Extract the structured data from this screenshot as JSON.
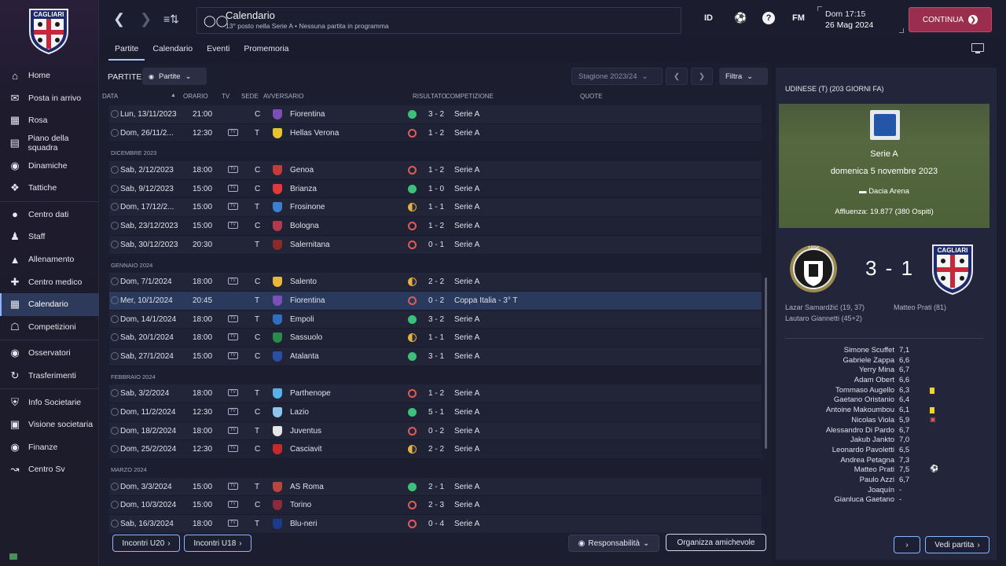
{
  "topbar": {
    "title": "Calendario",
    "subtitle": "13° posto nella Serie A • Nessuna partita in programma",
    "id_label": "ID",
    "help_label": "?",
    "fm_label": "FM",
    "date_line1": "Dom 17:15",
    "date_line2": "26 Mag 2024",
    "continue_label": "CONTINUA"
  },
  "sidebar": {
    "items": [
      {
        "label": "Home",
        "icon": "home-icon"
      },
      {
        "label": "Posta in arrivo",
        "icon": "mail-icon"
      },
      {
        "label": "Rosa",
        "icon": "shirt-icon"
      },
      {
        "label": "Piano della squadra",
        "icon": "clipboard-icon"
      },
      {
        "label": "Dinamiche",
        "icon": "brain-icon"
      },
      {
        "label": "Tattiche",
        "icon": "tactics-icon"
      },
      {
        "label": "Centro dati",
        "icon": "data-icon"
      },
      {
        "label": "Staff",
        "icon": "staff-icon"
      },
      {
        "label": "Allenamento",
        "icon": "cone-icon"
      },
      {
        "label": "Centro medico",
        "icon": "medical-icon"
      },
      {
        "label": "Calendario",
        "icon": "calendar-icon"
      },
      {
        "label": "Competizioni",
        "icon": "trophy-icon"
      },
      {
        "label": "Osservatori",
        "icon": "binoculars-icon"
      },
      {
        "label": "Trasferimenti",
        "icon": "transfer-icon"
      },
      {
        "label": "Info Societarie",
        "icon": "shield-icon"
      },
      {
        "label": "Visione societaria",
        "icon": "briefcase-icon"
      },
      {
        "label": "Finanze",
        "icon": "coins-icon"
      },
      {
        "label": "Centro Sv",
        "icon": "development-icon"
      }
    ],
    "active": "Calendario"
  },
  "tabs": [
    "Partite",
    "Calendario",
    "Eventi",
    "Promemoria"
  ],
  "active_tab": "Partite",
  "toolbar": {
    "label": "PARTITE",
    "view_dropdown": "Partite",
    "season": "Stagione 2023/24",
    "filter": "Filtra"
  },
  "columns": {
    "data": "DATA",
    "orario": "ORARIO",
    "tv": "TV",
    "sede": "SEDE",
    "avversario": "AVVERSARIO",
    "risultato": "RISULTATO",
    "competizione": "COMPETIZIONE",
    "quote": "QUOTE"
  },
  "rows": [
    {
      "type": "match",
      "data": "Lun, 13/11/2023",
      "orario": "21:00",
      "tv": false,
      "sede": "C",
      "team": "Fiorentina",
      "crest": "#7b4fb5",
      "outcome": "w",
      "score": "3 - 2",
      "comp": "Serie A"
    },
    {
      "type": "match",
      "data": "Dom, 26/11/2...",
      "orario": "12:30",
      "tv": true,
      "sede": "T",
      "team": "Hellas Verona",
      "crest": "#e8c32c",
      "outcome": "l",
      "score": "1 - 2",
      "comp": "Serie A"
    },
    {
      "type": "section",
      "label": "DICEMBRE 2023"
    },
    {
      "type": "match",
      "data": "Sab, 2/12/2023",
      "orario": "18:00",
      "tv": true,
      "sede": "C",
      "team": "Genoa",
      "crest": "#c43b3b",
      "outcome": "l",
      "score": "1 - 2",
      "comp": "Serie A"
    },
    {
      "type": "match",
      "data": "Sab, 9/12/2023",
      "orario": "15:00",
      "tv": true,
      "sede": "C",
      "team": "Brianza",
      "crest": "#e03a3a",
      "outcome": "w",
      "score": "1 - 0",
      "comp": "Serie A"
    },
    {
      "type": "match",
      "data": "Dom, 17/12/2...",
      "orario": "15:00",
      "tv": true,
      "sede": "T",
      "team": "Frosinone",
      "crest": "#3b7fd0",
      "outcome": "d",
      "score": "1 - 1",
      "comp": "Serie A"
    },
    {
      "type": "match",
      "data": "Sab, 23/12/2023",
      "orario": "15:00",
      "tv": true,
      "sede": "C",
      "team": "Bologna",
      "crest": "#b33a4a",
      "outcome": "l",
      "score": "1 - 2",
      "comp": "Serie A"
    },
    {
      "type": "match",
      "data": "Sab, 30/12/2023",
      "orario": "20:30",
      "tv": false,
      "sede": "T",
      "team": "Salernitana",
      "crest": "#8a2a2a",
      "outcome": "l",
      "score": "0 - 1",
      "comp": "Serie A"
    },
    {
      "type": "section",
      "label": "GENNAIO 2024"
    },
    {
      "type": "match",
      "data": "Dom, 7/1/2024",
      "orario": "18:00",
      "tv": true,
      "sede": "C",
      "team": "Salento",
      "crest": "#e8b83a",
      "outcome": "d",
      "score": "2 - 2",
      "comp": "Serie A"
    },
    {
      "type": "match",
      "data": "Mer, 10/1/2024",
      "orario": "20:45",
      "tv": false,
      "sede": "T",
      "team": "Fiorentina",
      "crest": "#7b4fb5",
      "outcome": "l",
      "score": "0 - 2",
      "comp": "Coppa Italia - 3° T",
      "selected": true
    },
    {
      "type": "match",
      "data": "Dom, 14/1/2024",
      "orario": "18:00",
      "tv": true,
      "sede": "T",
      "team": "Empoli",
      "crest": "#2f6fc0",
      "outcome": "w",
      "score": "3 - 2",
      "comp": "Serie A"
    },
    {
      "type": "match",
      "data": "Sab, 20/1/2024",
      "orario": "18:00",
      "tv": true,
      "sede": "C",
      "team": "Sassuolo",
      "crest": "#2a8a4a",
      "outcome": "d",
      "score": "1 - 1",
      "comp": "Serie A"
    },
    {
      "type": "match",
      "data": "Sab, 27/1/2024",
      "orario": "15:00",
      "tv": true,
      "sede": "C",
      "team": "Atalanta",
      "crest": "#2a4fa0",
      "outcome": "w",
      "score": "3 - 1",
      "comp": "Serie A"
    },
    {
      "type": "section",
      "label": "FEBBRAIO 2024"
    },
    {
      "type": "match",
      "data": "Sab, 3/2/2024",
      "orario": "18:00",
      "tv": true,
      "sede": "T",
      "team": "Parthenope",
      "crest": "#5ab0e8",
      "outcome": "l",
      "score": "1 - 2",
      "comp": "Serie A"
    },
    {
      "type": "match",
      "data": "Dom, 11/2/2024",
      "orario": "12:30",
      "tv": true,
      "sede": "C",
      "team": "Lazio",
      "crest": "#8fc4ec",
      "outcome": "w",
      "score": "5 - 1",
      "comp": "Serie A"
    },
    {
      "type": "match",
      "data": "Dom, 18/2/2024",
      "orario": "18:00",
      "tv": true,
      "sede": "T",
      "team": "Juventus",
      "crest": "#e6e6e6",
      "outcome": "l",
      "score": "0 - 2",
      "comp": "Serie A"
    },
    {
      "type": "match",
      "data": "Dom, 25/2/2024",
      "orario": "12:30",
      "tv": true,
      "sede": "C",
      "team": "Casciavit",
      "crest": "#c42a2a",
      "outcome": "d",
      "score": "2 - 2",
      "comp": "Serie A"
    },
    {
      "type": "section",
      "label": "MARZO 2024"
    },
    {
      "type": "match",
      "data": "Dom, 3/3/2024",
      "orario": "15:00",
      "tv": true,
      "sede": "T",
      "team": "AS Roma",
      "crest": "#b8463a",
      "outcome": "w",
      "score": "2 - 1",
      "comp": "Serie A"
    },
    {
      "type": "match",
      "data": "Dom, 10/3/2024",
      "orario": "15:00",
      "tv": true,
      "sede": "C",
      "team": "Torino",
      "crest": "#8a2a3a",
      "outcome": "l",
      "score": "2 - 3",
      "comp": "Serie A"
    },
    {
      "type": "match",
      "data": "Sab, 16/3/2024",
      "orario": "18:00",
      "tv": true,
      "sede": "T",
      "team": "Blu-neri",
      "crest": "#1a3a8a",
      "outcome": "l",
      "score": "0 - 4",
      "comp": "Serie A"
    }
  ],
  "bottom_buttons": {
    "u20": "Incontri U20",
    "u18": "Incontri U18",
    "responsabilita": "Responsabilità",
    "amichevole": "Organizza amichevole",
    "vedi": "Vedi partita"
  },
  "match_panel": {
    "title": "UDINESE (T) (203 GIORNI FA)",
    "competition": "Serie A",
    "date": "domenica 5 novembre 2023",
    "stadium": "Dacia Arena",
    "attendance": "Affluenza: 19.877 (380 Ospiti)",
    "score": "3 - 1",
    "home_scorer1": "Lazar Samardžić (19, 37)",
    "home_scorer2": "Lautaro Giannetti (45+2)",
    "away_scorer": "Matteo Prati (81)",
    "home_badge_text": "1896",
    "away_badge_text": "CAGLIARI",
    "players": [
      {
        "name": "Simone Scuffet",
        "rating": "7,1"
      },
      {
        "name": "Gabriele Zappa",
        "rating": "6,6"
      },
      {
        "name": "Yerry Mina",
        "rating": "6,7"
      },
      {
        "name": "Adam Obert",
        "rating": "6,6"
      },
      {
        "name": "Tommaso Augello",
        "rating": "6,3",
        "event": "yellow"
      },
      {
        "name": "Gaetano Oristanio",
        "rating": "6,4"
      },
      {
        "name": "Antoine Makoumbou",
        "rating": "6,1",
        "event": "yellow"
      },
      {
        "name": "Nicolas Viola",
        "rating": "5,9",
        "event": "injury"
      },
      {
        "name": "Alessandro Di Pardo",
        "rating": "6,7"
      },
      {
        "name": "Jakub Jankto",
        "rating": "7,0"
      },
      {
        "name": "Leonardo Pavoletti",
        "rating": "6,5"
      },
      {
        "name": "Andrea Petagna",
        "rating": "7,3"
      },
      {
        "name": "Matteo Prati",
        "rating": "7,5",
        "event": "goal"
      },
      {
        "name": "Paulo Azzi",
        "rating": "6,7"
      },
      {
        "name": "Joaquín",
        "rating": "-"
      },
      {
        "name": "Gianluca Gaetano",
        "rating": "-"
      }
    ]
  }
}
